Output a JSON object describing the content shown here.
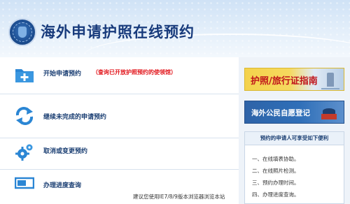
{
  "header": {
    "title": "海外申请护照在线预约"
  },
  "menu": {
    "items": [
      {
        "label": "开始申请预约",
        "note": "（查询已开放护照预约的使领馆）",
        "icon": "folder-plus-icon"
      },
      {
        "label": "继续未完成的申请预约",
        "icon": "refresh-arrows-icon"
      },
      {
        "label": "取消或变更预约",
        "icon": "gears-icon"
      },
      {
        "label": "办理进度查询",
        "icon": "progress-bar-icon"
      }
    ]
  },
  "footer": {
    "browser_note": "建议您使用IE7/8/9版本浏览器浏览本站"
  },
  "sidebar": {
    "banner_guide": "护照/旅行证指南",
    "banner_register": "海外公民自愿登记",
    "info_title": "预约的申请人可享受如下便利",
    "info_items": [
      "一、在线填表协助。",
      "二、在线照片检测。",
      "三、预约办理时间。",
      "四、办理进度查询。"
    ]
  },
  "colors": {
    "title": "#183b7c",
    "note_red": "#e2151b",
    "icon_blue": "#2b86d4",
    "guide_banner_yellow": "#f4d24c",
    "register_banner_blue": "#2e63a8"
  }
}
